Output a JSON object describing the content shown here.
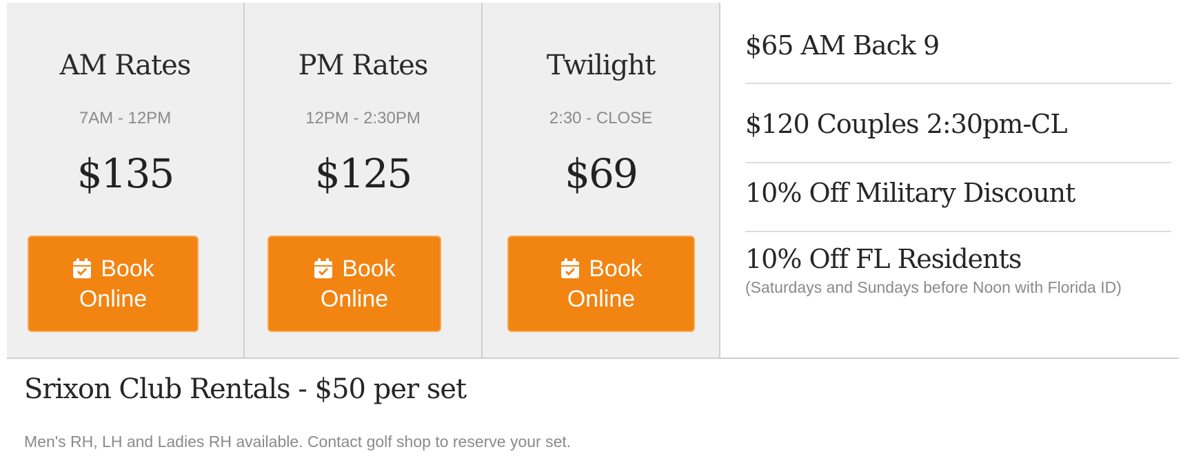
{
  "rates": [
    {
      "title": "AM Rates",
      "time": "7AM - 12PM",
      "price": "$135",
      "button_line1": "Book",
      "button_line2": "Online"
    },
    {
      "title": "PM Rates",
      "time": "12PM - 2:30PM",
      "price": "$125",
      "button_line1": "Book",
      "button_line2": "Online"
    },
    {
      "title": "Twilight",
      "time": "2:30 - CLOSE",
      "price": "$69",
      "button_line1": "Book",
      "button_line2": "Online"
    }
  ],
  "specials": [
    {
      "title": "$65 AM Back 9"
    },
    {
      "title": "$120 Couples 2:30pm-CL"
    },
    {
      "title": "10% Off Military Discount"
    },
    {
      "title": "10% Off FL Residents",
      "note": "(Saturdays and Sundays before Noon with Florida ID)"
    }
  ],
  "club_rentals": {
    "title": "Srixon Club Rentals - $50 per set",
    "description": "Men's RH, LH and Ladies RH available. Contact golf shop to reserve your set."
  },
  "colors": {
    "button": "#f28412",
    "card_bg": "#efefef"
  },
  "icons": {
    "book_button": "calendar-check-icon"
  }
}
